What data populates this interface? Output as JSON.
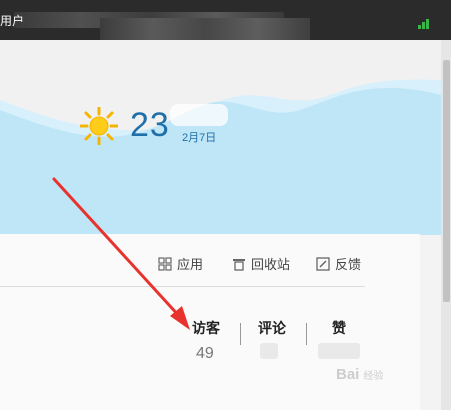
{
  "topbar": {
    "user_text": "用户",
    "signal_color": "#39b54a"
  },
  "weather": {
    "icon": "sun-icon",
    "temperature": "23",
    "date": "2月7日",
    "text_color": "#1f6fa8",
    "sky_color": "#bfe6f7"
  },
  "toolbar": {
    "items": [
      {
        "icon": "apps-grid-icon",
        "label": "应用"
      },
      {
        "icon": "trash-icon",
        "label": "回收站"
      },
      {
        "icon": "feedback-edit-icon",
        "label": "反馈"
      }
    ]
  },
  "stats": [
    {
      "label": "访客",
      "value": "49"
    },
    {
      "label": "评论",
      "value": ""
    },
    {
      "label": "赞",
      "value": ""
    }
  ],
  "annotation": {
    "arrow_color": "#e8322d"
  },
  "watermark": {
    "text": "Bai",
    "suffix": "经验"
  }
}
